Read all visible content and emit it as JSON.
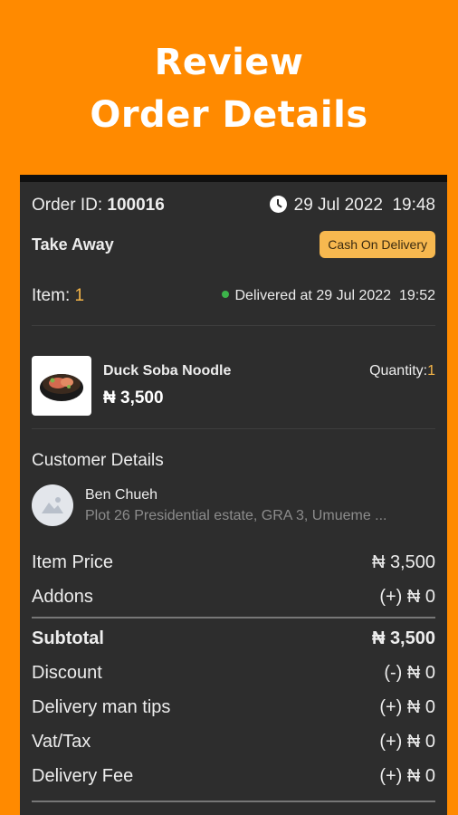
{
  "promo": {
    "line1": "Review",
    "line2": "Order Details"
  },
  "order": {
    "id_label": "Order ID:",
    "id_value": "100016",
    "date": "29 Jul 2022",
    "time": "19:48",
    "order_type": "Take Away",
    "payment_badge": "Cash On Delivery",
    "item_label": "Item:",
    "item_count": "1",
    "status_text": "Delivered at 29 Jul 2022",
    "status_time": "19:52"
  },
  "product": {
    "name": "Duck Soba Noodle",
    "price": "₦ 3,500",
    "quantity_label": "Quantity:",
    "quantity_value": "1"
  },
  "customer": {
    "section_title": "Customer Details",
    "name": "Ben Chueh",
    "address": "Plot 26 Presidential estate, GRA 3, Umueme ..."
  },
  "summary": {
    "item_price_label": "Item Price",
    "item_price_value": "₦ 3,500",
    "addons_label": "Addons",
    "addons_value": "(+) ₦ 0",
    "subtotal_label": "Subtotal",
    "subtotal_value": "₦ 3,500",
    "discount_label": "Discount",
    "discount_value": "(-) ₦ 0",
    "tips_label": "Delivery man tips",
    "tips_value": "(+) ₦ 0",
    "vat_label": "Vat/Tax",
    "vat_value": "(+) ₦ 0",
    "fee_label": "Delivery Fee",
    "fee_value": "(+) ₦ 0"
  },
  "colors": {
    "background": "#FF8A00",
    "panel": "#2D2D2D",
    "accent": "#F5B548",
    "status_dot": "#3CB44A"
  },
  "icons": {
    "clock": "clock-icon",
    "avatar": "image-placeholder-icon"
  }
}
